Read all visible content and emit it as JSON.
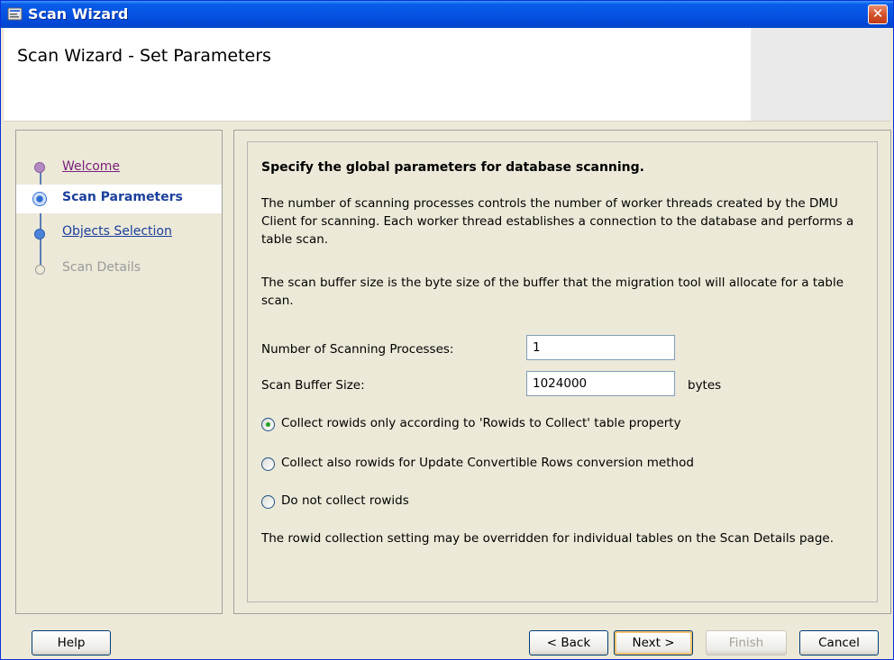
{
  "window": {
    "title": "Scan Wizard",
    "close_glyph": "✕"
  },
  "header": {
    "page_title": "Scan Wizard - Set Parameters"
  },
  "nav": {
    "items": [
      {
        "label": "Welcome",
        "state": "visited"
      },
      {
        "label": "Scan Parameters",
        "state": "current"
      },
      {
        "label": "Objects Selection",
        "state": "link"
      },
      {
        "label": "Scan Details",
        "state": "disabled"
      }
    ]
  },
  "content": {
    "heading": "Specify the global parameters for database scanning.",
    "para1": "The number of scanning processes controls the number of worker threads created by the DMU Client for scanning. Each worker thread establishes a connection to the database and performs a table scan.",
    "para2": "The scan buffer size is the byte size of the buffer that the migration tool will allocate for a table scan.",
    "processes_label": "Number of Scanning Processes:",
    "processes_value": "1",
    "buffer_label": "Scan Buffer Size:",
    "buffer_value": "1024000",
    "buffer_unit": "bytes",
    "radio_options": [
      {
        "label": "Collect rowids only according to 'Rowids to Collect' table property",
        "checked": true
      },
      {
        "label": "Collect also rowids for Update Convertible Rows conversion method",
        "checked": false
      },
      {
        "label": "Do not collect rowids",
        "checked": false
      }
    ],
    "footnote": "The rowid collection setting may be overridden for individual tables on the Scan Details page."
  },
  "buttons": {
    "help": "Help",
    "back": "< Back",
    "next": "Next >",
    "finish": "Finish",
    "cancel": "Cancel"
  }
}
